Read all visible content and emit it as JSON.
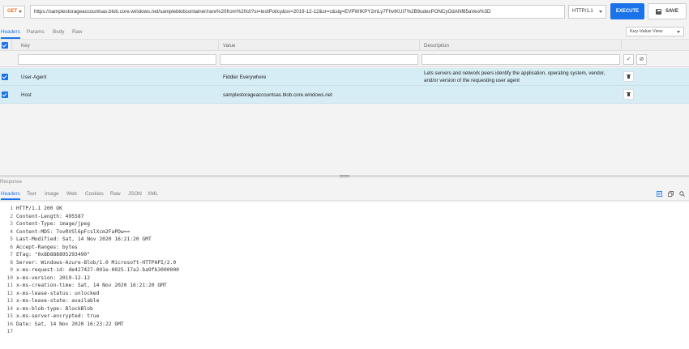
{
  "request": {
    "method": "GET",
    "url": "https://samplestorageaccountsas.blob.core.windows.net/sampleblobcontainer/rare%20from%20cli?si=testPolicy&sv=2019-12-12&sr=c&sig=EVPWIKPY2mLy7FhvIKUI7%2B9udexPONCyOdANf85aVeo%3D",
    "protocol": "HTTP/1.1",
    "execute_label": "EXECUTE",
    "save_label": "SAVE"
  },
  "request_tabs": [
    "Headers",
    "Params",
    "Body",
    "Raw"
  ],
  "view_select": "Key-Value View",
  "columns": {
    "key": "Key",
    "value": "Value",
    "description": "Description"
  },
  "headers": [
    {
      "key": "User-Agent",
      "value": "Fiddler Everywhere",
      "description_line1": "Lets servers and network peers identify the application, operating system, vendor,",
      "description_line2": "and/or version of the requesting user agent"
    },
    {
      "key": "Host",
      "value": "samplestorageaccountsas.blob.core.windows.net",
      "description_line1": "",
      "description_line2": ""
    }
  ],
  "response_label": "Response",
  "response_tabs": [
    "Headers",
    "Text",
    "Image",
    "Web",
    "Cookies",
    "Raw",
    "JSON",
    "XML"
  ],
  "response_lines": [
    {
      "n": "1",
      "text": "HTTP/1.1 200 OK"
    },
    {
      "n": "2",
      "text": "Content-Length: 495587"
    },
    {
      "n": "3",
      "text": "Content-Type: image/jpeg"
    },
    {
      "n": "4",
      "text": "Content-MD5: 7ovRVSl6pFcslXcm2FaPDw=="
    },
    {
      "n": "5",
      "text": "Last-Modified: Sat, 14 Nov 2020 16:21:20 GMT"
    },
    {
      "n": "6",
      "text": "Accept-Ranges: bytes"
    },
    {
      "n": "7",
      "text": "ETag: \"0x8D888895293490\""
    },
    {
      "n": "8",
      "text": "Server: Windows-Azure-Blob/1.0 Microsoft-HTTPAPI/2.0"
    },
    {
      "n": "9",
      "text": "x-ms-request-id: de427427-001e-0025-17a2-ba9fb3000000"
    },
    {
      "n": "10",
      "text": "x-ms-version: 2019-12-12"
    },
    {
      "n": "11",
      "text": "x-ms-creation-time: Sat, 14 Nov 2020 16:21:20 GMT"
    },
    {
      "n": "12",
      "text": "x-ms-lease-status: unlocked"
    },
    {
      "n": "13",
      "text": "x-ms-lease-state: available"
    },
    {
      "n": "14",
      "text": "x-ms-blob-type: BlockBlob"
    },
    {
      "n": "15",
      "text": "x-ms-server-encrypted: true"
    },
    {
      "n": "16",
      "text": "Date: Sat, 14 Nov 2020 16:23:22 GMT"
    },
    {
      "n": "17",
      "text": ""
    }
  ],
  "colors": {
    "accent": "#1a73e8",
    "method": "#e8702a",
    "row_selected": "#d6edf6"
  }
}
